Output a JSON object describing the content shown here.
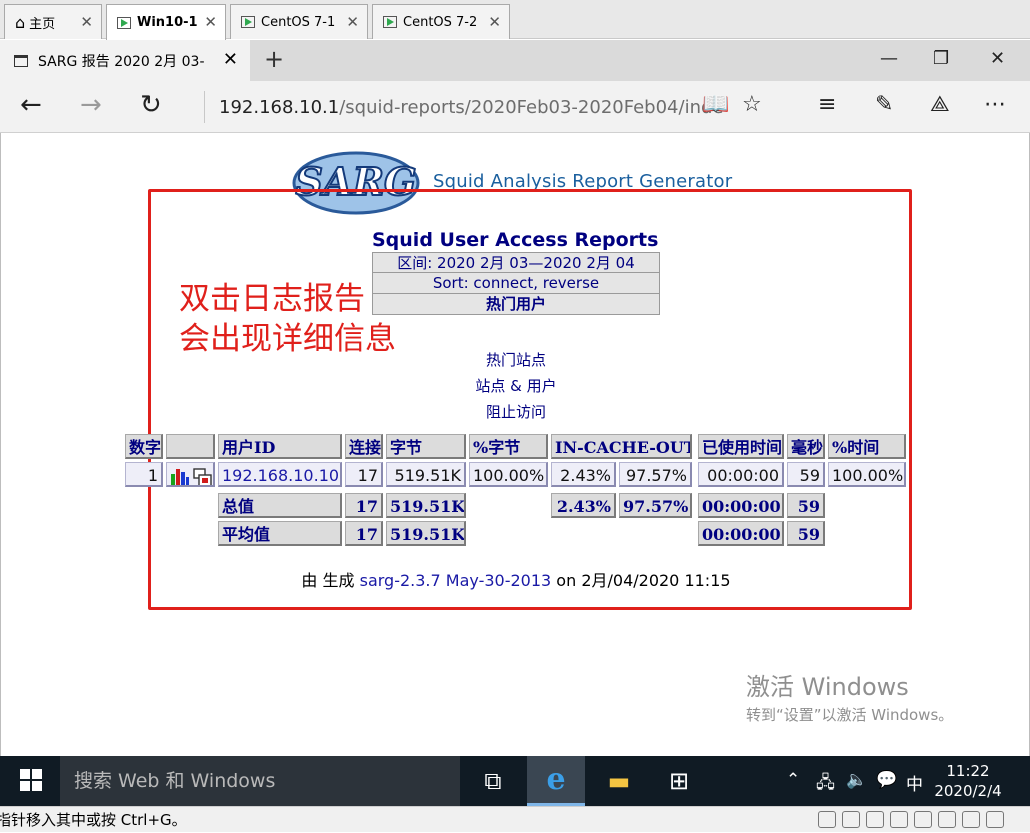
{
  "vm_tabs": [
    {
      "label": "主页"
    },
    {
      "label": "Win10-1"
    },
    {
      "label": "CentOS 7-1"
    },
    {
      "label": "CentOS 7-2"
    }
  ],
  "browser": {
    "tab_title": "SARG 报告 2020 2月 03-",
    "url_host": "192.168.10.1",
    "url_path": "/squid-reports/2020Feb03-2020Feb04/inde"
  },
  "report": {
    "logo_text": "SARG",
    "generator": "Squid Analysis Report Generator",
    "title": "Squid User Access Reports",
    "period": "区间: 2020 2月 03—2020 2月 04",
    "sort": "Sort: connect, reverse",
    "top_users": "热门用户",
    "links": [
      "热门站点",
      "站点 & 用户",
      "阻止访问"
    ],
    "table": {
      "headers": [
        "数字",
        "",
        "用户ID",
        "连接",
        "字节",
        "%字节",
        "IN-CACHE-OUT",
        "已使用时间",
        "毫秒",
        "%时间"
      ],
      "row": {
        "num": "1",
        "user": "192.168.10.10",
        "connect": "17",
        "bytes": "519.51K",
        "pct_bytes": "100.00%",
        "in_cache": "2.43%",
        "out_cache": "97.57%",
        "elapsed": "00:00:00",
        "ms": "59",
        "pct_time": "100.00%"
      },
      "total": {
        "label": "总值",
        "connect": "17",
        "bytes": "519.51K",
        "in_cache": "2.43%",
        "out_cache": "97.57%",
        "elapsed": "00:00:00",
        "ms": "59"
      },
      "average": {
        "label": "平均值",
        "connect": "17",
        "bytes": "519.51K",
        "elapsed": "00:00:00",
        "ms": "59"
      }
    },
    "footer_prefix": "由 生成",
    "footer_link": "sarg-2.3.7 May-30-2013",
    "footer_date": "on 2月/04/2020 11:15"
  },
  "annotation": {
    "line1": "双击日志报告",
    "line2": "会出现详细信息",
    "color": "#e0201b"
  },
  "watermark": {
    "line1": "激活 Windows",
    "line2": "转到“设置”以激活 Windows。"
  },
  "taskbar": {
    "search_placeholder": "搜索 Web 和 Windows",
    "ime": "中",
    "time": "11:22",
    "date": "2020/2/4"
  },
  "statusbar": {
    "message": "指针移入其中或按 Ctrl+G。"
  }
}
